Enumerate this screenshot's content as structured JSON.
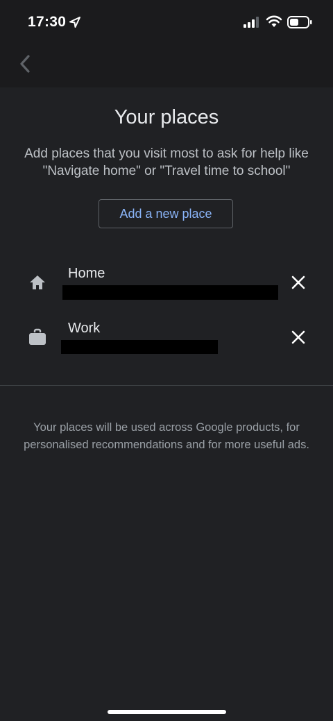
{
  "status_bar": {
    "time": "17:30",
    "icons": [
      "location-arrow-icon",
      "cellular-signal-icon",
      "wifi-icon",
      "battery-icon"
    ]
  },
  "top_bar": {
    "back_icon": "chevron-left-icon"
  },
  "main": {
    "title": "Your places",
    "description": "Add places that you visit most to ask for help like \"Navigate home\" or \"Travel time to school\"",
    "add_button_label": "Add a new place",
    "places": [
      {
        "label": "Home",
        "icon": "home-icon",
        "remove_icon": "close-icon",
        "address_hidden": true
      },
      {
        "label": "Work",
        "icon": "briefcase-icon",
        "remove_icon": "close-icon",
        "address_hidden": true
      }
    ],
    "footer_note": "Your places will be used across Google products, for personalised recommendations and for more useful ads."
  },
  "colors": {
    "background": "#202124",
    "bar_background": "#1b1b1d",
    "accent": "#8ab4f8",
    "primary_text": "#e8eaed",
    "secondary_text": "#bdc1c6",
    "muted_text": "#9aa0a6",
    "icon": "#bdc1c6"
  }
}
